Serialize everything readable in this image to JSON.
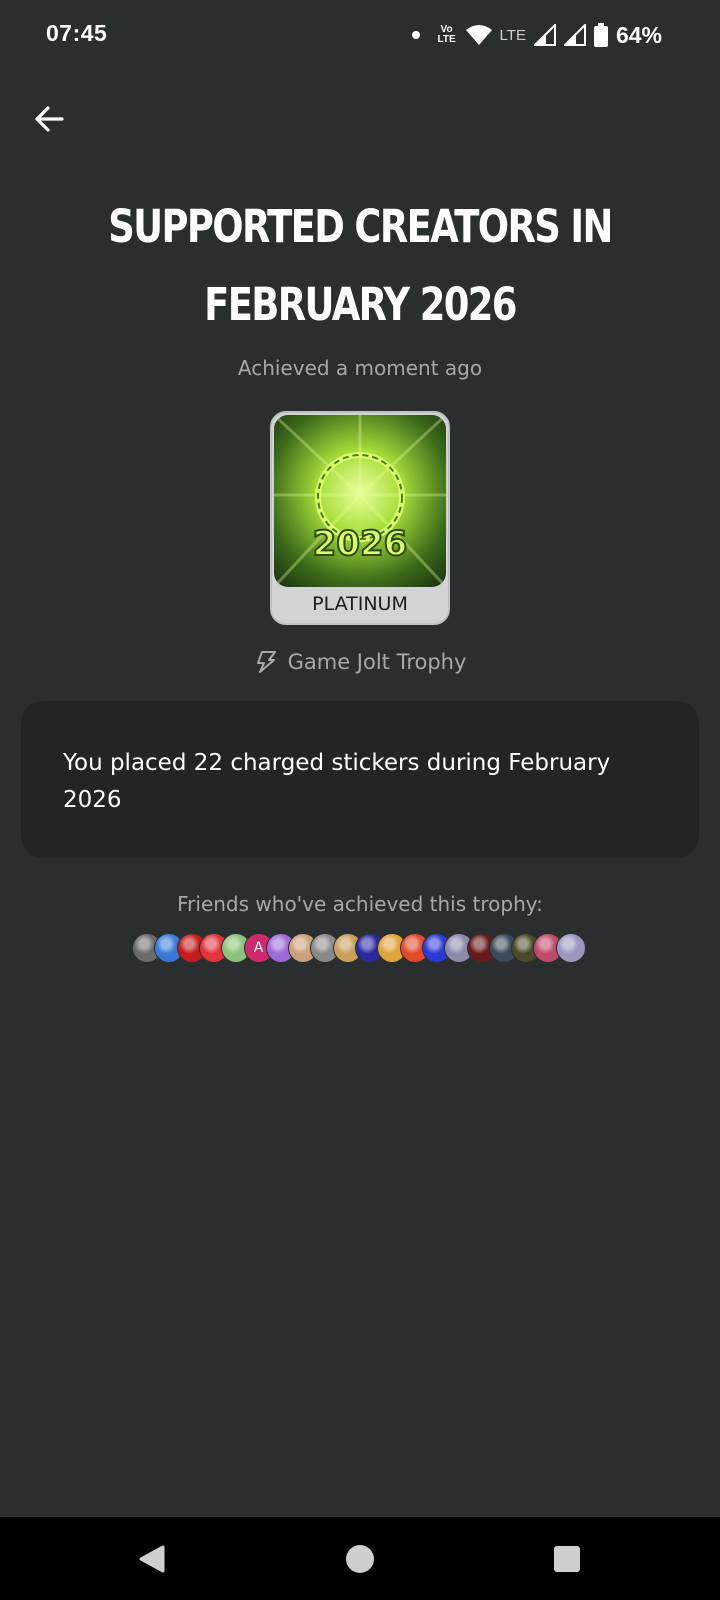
{
  "status_bar": {
    "time": "07:45",
    "network": "LTE",
    "volte": "Vo LTE",
    "battery": "64%"
  },
  "header": {
    "back_icon": "arrow-left-icon"
  },
  "trophy": {
    "title": "SUPPORTED CREATORS IN FEBRUARY 2026",
    "achieved_text": "Achieved a moment ago",
    "image_text": "2026",
    "tier": "PLATINUM",
    "source": "Game Jolt Trophy",
    "source_icon": "game-jolt-bolt-icon",
    "description": "You placed 22 charged stickers during February 2026"
  },
  "friends": {
    "label": "Friends who've achieved this trophy:",
    "avatars": [
      "#6b6b6b",
      "#3a7ad6",
      "#c41d1d",
      "#e0353a",
      "#8bc27a",
      "#d02a6e",
      "#9c6ad6",
      "#c9a17a",
      "#8a8a8a",
      "#c9a05a",
      "#2a2aa0",
      "#e0a23a",
      "#e04a2a",
      "#2a3ad6",
      "#8a8aaa",
      "#6a1a1a",
      "#3a4a5a",
      "#4a4a2a",
      "#c04a6a",
      "#9a9ac0"
    ],
    "avatar_letter": "A"
  },
  "colors": {
    "background": "#2b2e2e",
    "card": "#222525",
    "muted_text": "#a6a9a9",
    "accent_green": "#b8f040"
  }
}
